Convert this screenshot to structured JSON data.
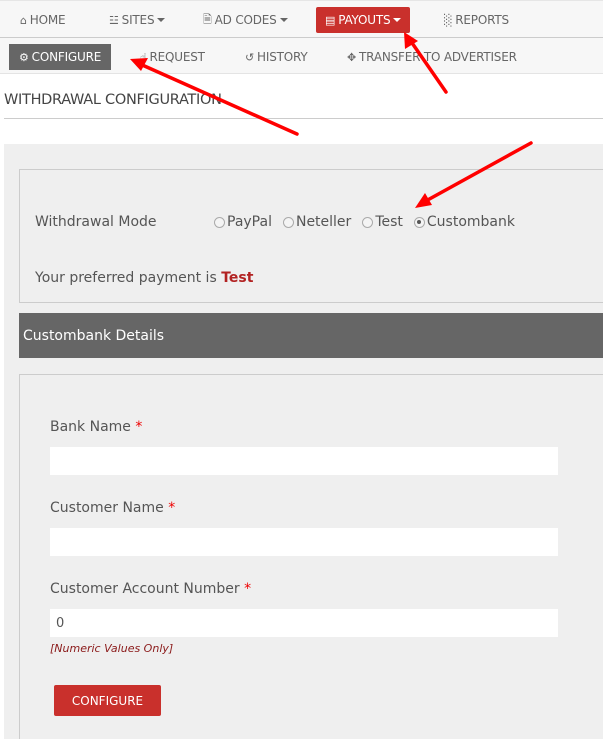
{
  "topnav": {
    "items": [
      {
        "label": "HOME",
        "icon": "home-icon"
      },
      {
        "label": "SITES",
        "icon": "sitemap-icon",
        "dropdown": true
      },
      {
        "label": "AD CODES",
        "icon": "code-file-icon",
        "dropdown": true
      },
      {
        "label": "PAYOUTS",
        "icon": "credit-card-icon",
        "dropdown": true,
        "active": true
      },
      {
        "label": "REPORTS",
        "icon": "bar-chart-icon"
      }
    ]
  },
  "subnav": {
    "items": [
      {
        "label": "CONFIGURE",
        "icon": "gear-icon",
        "active": true
      },
      {
        "label": "REQUEST",
        "icon": "hand-pointer-icon"
      },
      {
        "label": "HISTORY",
        "icon": "history-icon"
      },
      {
        "label": "TRANSFER TO ADVERTISER",
        "icon": "move-icon"
      }
    ]
  },
  "page": {
    "title": "WITHDRAWAL CONFIGURATION"
  },
  "withdrawal": {
    "mode_label": "Withdrawal Mode",
    "options": [
      "PayPal",
      "Neteller",
      "Test",
      "Custombank"
    ],
    "selected": "Custombank",
    "preferred_prefix": "Your preferred payment is",
    "preferred_value": "Test"
  },
  "details": {
    "header": "Custombank Details",
    "fields": [
      {
        "label": "Bank Name",
        "required_mark": "*",
        "value": ""
      },
      {
        "label": "Customer Name",
        "required_mark": "*",
        "value": ""
      },
      {
        "label": "Customer Account Number",
        "required_mark": "*",
        "value": "0"
      }
    ],
    "hint": "[Numeric Values Only]",
    "submit_label": "CONFIGURE"
  },
  "colors": {
    "accent_red": "#c9302c",
    "active_grey": "#666666",
    "annotation_arrow": "#ff0000"
  }
}
